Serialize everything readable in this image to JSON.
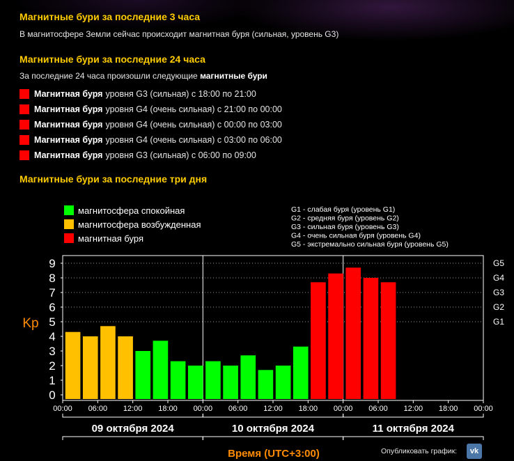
{
  "section1": {
    "title": "Магнитные бури за последние 3 часа",
    "text": "В магнитосфере Земли сейчас происходит магнитная буря (сильная, уровень G3)"
  },
  "section2": {
    "title": "Магнитные бури за последние 24 часа",
    "intro_prefix": "За последние 24 часа произошли следующие ",
    "intro_bold": "магнитные бури",
    "storms": [
      {
        "bold": "Магнитная буря",
        "rest": "уровня G3 (сильная) с 18:00 по 21:00"
      },
      {
        "bold": "Магнитная буря",
        "rest": "уровня G4 (очень сильная) с 21:00 по 00:00"
      },
      {
        "bold": "Магнитная буря",
        "rest": "уровня G4 (очень сильная) с 00:00 по 03:00"
      },
      {
        "bold": "Магнитная буря",
        "rest": "уровня G4 (очень сильная) с 03:00 по 06:00"
      },
      {
        "bold": "Магнитная буря",
        "rest": "уровня G3 (сильная) с 06:00 по 09:00"
      }
    ],
    "storm_color": "#ff0000"
  },
  "section3": {
    "title": "Магнитные бури за последние три дня"
  },
  "share": {
    "label": "Опубликовать график:",
    "vk": "vk"
  },
  "chart_data": {
    "type": "bar",
    "ylabel": "Kp",
    "xlabel": "Время (UTC+3:00)",
    "ylim": [
      0,
      9
    ],
    "yticks": [
      "0",
      "1",
      "2",
      "3",
      "4",
      "5",
      "6",
      "7",
      "8",
      "9"
    ],
    "g_levels": [
      {
        "label": "G1",
        "kp": 5
      },
      {
        "label": "G2",
        "kp": 6
      },
      {
        "label": "G3",
        "kp": 7
      },
      {
        "label": "G4",
        "kp": 8
      },
      {
        "label": "G5",
        "kp": 9
      }
    ],
    "xticks": [
      "00:00",
      "06:00",
      "12:00",
      "18:00",
      "00:00",
      "06:00",
      "12:00",
      "18:00",
      "00:00",
      "06:00",
      "12:00",
      "18:00",
      "00:00"
    ],
    "days": [
      "09 октября 2024",
      "10 октября 2024",
      "11 октября 2024"
    ],
    "legend": [
      {
        "label": "магнитосфера спокойная",
        "color": "#00ff00"
      },
      {
        "label": "магнитосфера возбужденная",
        "color": "#ffc000"
      },
      {
        "label": "магнитная буря",
        "color": "#ff0000"
      }
    ],
    "g_legend": [
      "G1 - слабая буря (уровень G1)",
      "G2 - средняя буря (уровень G2)",
      "G3 - сильная буря (уровень G3)",
      "G4 - очень сильная буря (уровень G4)",
      "G5 - экстремально сильная буря (уровень G5)"
    ],
    "colors": {
      "quiet": "#00ff00",
      "active": "#ffc000",
      "storm": "#ff0000"
    },
    "values": [
      4.3,
      4.0,
      4.7,
      4.0,
      3.0,
      3.7,
      2.3,
      2.0,
      2.3,
      2.0,
      2.7,
      1.7,
      2.0,
      3.3,
      7.7,
      8.3,
      8.7,
      8.0,
      7.7
    ],
    "status": [
      "active",
      "active",
      "active",
      "active",
      "quiet",
      "quiet",
      "quiet",
      "quiet",
      "quiet",
      "quiet",
      "quiet",
      "quiet",
      "quiet",
      "quiet",
      "storm",
      "storm",
      "storm",
      "storm",
      "storm"
    ]
  }
}
